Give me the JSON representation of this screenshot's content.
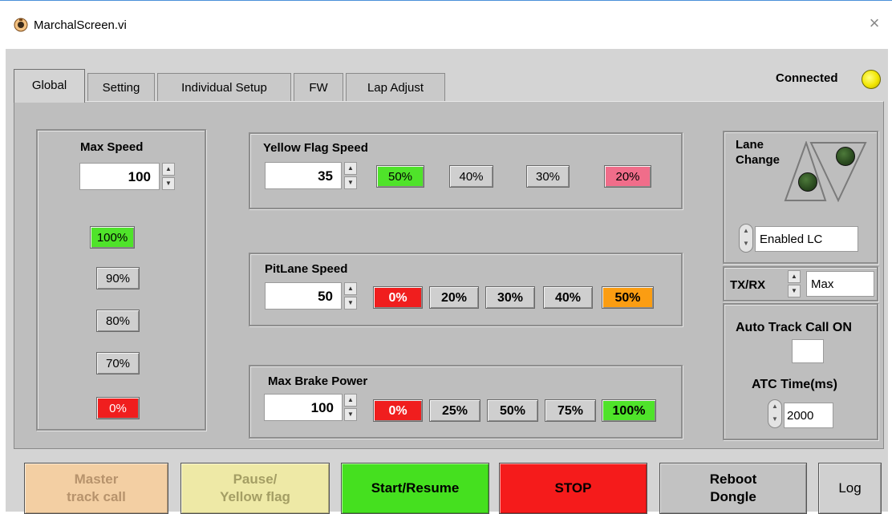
{
  "window": {
    "title": "MarchalScreen.vi"
  },
  "tabs": [
    "Global",
    "Setting",
    "Individual Setup",
    "FW",
    "Lap Adjust"
  ],
  "status": {
    "connected_label": "Connected",
    "connected_led_color": "#f2e600"
  },
  "max_speed": {
    "label": "Max Speed",
    "value": "100",
    "presets": [
      "100%",
      "90%",
      "80%",
      "70%",
      "0%"
    ]
  },
  "yellow_flag": {
    "label": "Yellow Flag Speed",
    "value": "35",
    "presets": [
      "50%",
      "40%",
      "30%",
      "20%"
    ]
  },
  "pitlane": {
    "label": "PitLane Speed",
    "value": "50",
    "presets": [
      "0%",
      "20%",
      "30%",
      "40%",
      "50%"
    ]
  },
  "brake": {
    "label": "Max Brake Power",
    "value": "100",
    "presets": [
      "0%",
      "25%",
      "50%",
      "75%",
      "100%"
    ]
  },
  "lane_change": {
    "label_line1": "Lane",
    "label_line2": "Change",
    "mode": "Enabled LC"
  },
  "txrx": {
    "label": "TX/RX",
    "value": "Max"
  },
  "auto_track": {
    "label": "Auto Track Call ON",
    "atc_label": "ATC Time(ms)",
    "atc_value": "2000"
  },
  "bottom_buttons": {
    "master_line1": "Master",
    "master_line2": "track call",
    "pause_line1": "Pause/",
    "pause_line2": "Yellow flag",
    "start": "Start/Resume",
    "stop": "STOP",
    "reboot_line1": "Reboot",
    "reboot_line2": "Dongle",
    "log": "Log"
  },
  "colors": {
    "green": "#4fe32a",
    "red": "#f01e1e",
    "pink": "#f06d8a",
    "orange": "#fb9d12",
    "master_btn": "#f3cfa3",
    "pause_btn": "#eee9a6",
    "start_btn": "#45e01f",
    "stop_btn": "#f51b1b"
  }
}
